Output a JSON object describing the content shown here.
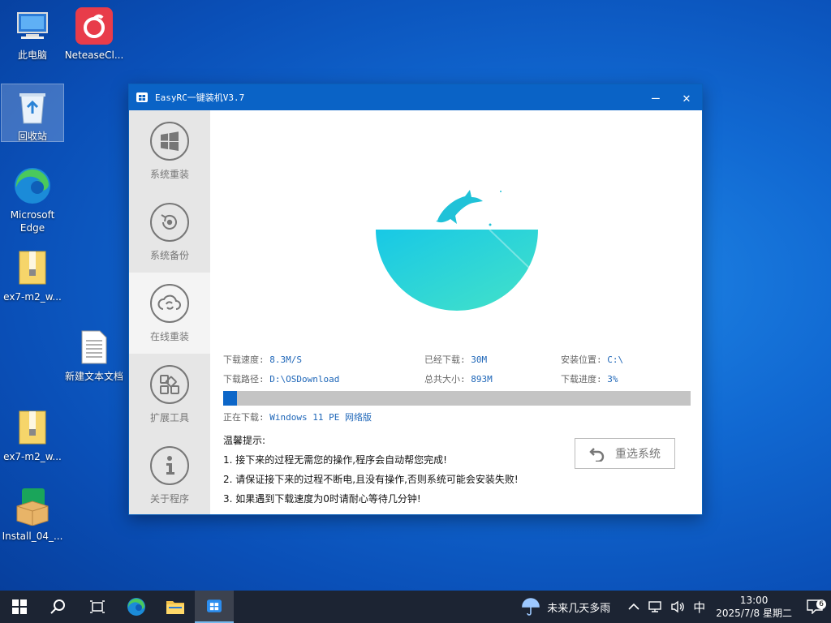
{
  "desktop": {
    "icons": [
      {
        "label": "此电脑"
      },
      {
        "label": "NeteaseCl..."
      },
      {
        "label": "回收站"
      },
      {
        "label": "Microsoft Edge"
      },
      {
        "label": "ex7-m2_w..."
      },
      {
        "label": "新建文本文档"
      },
      {
        "label": "ex7-m2_w..."
      },
      {
        "label": "Install_04_..."
      }
    ]
  },
  "window": {
    "title": "EasyRC一键装机V3.7",
    "minimize": "—",
    "close": "✕",
    "sidebar": [
      {
        "label": "系统重装",
        "icon": "windows-icon"
      },
      {
        "label": "系统备份",
        "icon": "backup-icon"
      },
      {
        "label": "在线重装",
        "icon": "cloud-sync-icon"
      },
      {
        "label": "扩展工具",
        "icon": "apps-grid-icon"
      },
      {
        "label": "关于程序",
        "icon": "info-icon"
      }
    ],
    "stats": {
      "speed_label": "下载速度:",
      "speed_value": "8.3M/S",
      "downloaded_label": "已经下载:",
      "downloaded_value": "30M",
      "install_label": "安装位置:",
      "install_value": "C:\\",
      "path_label": "下载路径:",
      "path_value": "D:\\OSDownload",
      "total_label": "总共大小:",
      "total_value": "893M",
      "progress_label": "下载进度:",
      "progress_value": "3%"
    },
    "progress_fraction": 0.03,
    "downloading_label": "正在下载:",
    "downloading_value": "Windows 11 PE 网络版",
    "tips_title": "温馨提示:",
    "tips": [
      "1.  接下来的过程无需您的操作,程序会自动帮您完成!",
      "2.  请保证接下来的过程不断电,且没有操作,否则系统可能会安装失败!",
      "3.  如果遇到下载速度为0时请耐心等待几分钟!"
    ],
    "reselect_button": "重选系统"
  },
  "taskbar": {
    "weather": "未来几天多雨",
    "ime": "中",
    "time": "13:00",
    "date": "2025/7/8 星期二",
    "notification_count": "6"
  },
  "colors": {
    "accent": "#0a63c6",
    "sidebar_bg": "#e6e6e6",
    "progress_fill": "#0c66c8",
    "bowl": "#2ad4dc"
  }
}
